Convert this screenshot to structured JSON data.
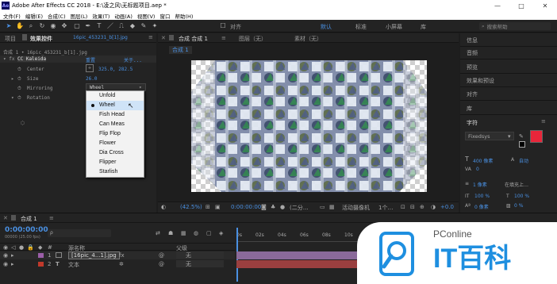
{
  "window": {
    "title": "Adobe After Effects CC 2018 - E:\\凌之风\\无标题项目.aep *",
    "logo_text": "Ae",
    "controls": [
      "—",
      "□",
      "✕"
    ]
  },
  "menu": [
    "文件(F)",
    "编辑(E)",
    "合成(C)",
    "图层(L)",
    "效果(T)",
    "动画(A)",
    "视图(V)",
    "窗口",
    "帮助(H)"
  ],
  "toolbar": {
    "align_label": "对齐",
    "workspaces": [
      "默认",
      "标准",
      "小屏幕",
      "库"
    ],
    "search_placeholder": "搜索帮助"
  },
  "project_panel": {
    "tab_project": "项目",
    "tab_effect": "效果控件",
    "tab_layer": "16pic_453231_b[1].jpg",
    "layer_path": "合成 1 • 16pic_453231_b[1].jpg",
    "effect_name": "CC Kaleida",
    "reset_label": "重置",
    "about_label": "关于...",
    "props": [
      {
        "label": "Center",
        "value": "325.0, 282.5"
      },
      {
        "label": "Size",
        "value": "26.0"
      },
      {
        "label": "Mirroring",
        "value": "Wheel"
      },
      {
        "label": "Rotation",
        "value": ""
      }
    ]
  },
  "dropdown": {
    "options": [
      "Unfold",
      "Wheel",
      "Fish Head",
      "Can Meas",
      "Flip Flop",
      "Flower",
      "Dia Cross",
      "Flipper",
      "Starlish"
    ],
    "selected": "Wheel"
  },
  "comp_panel": {
    "tab_comp": "合成 合成 1",
    "tab_layer": "图层（无）",
    "tab_footage": "素材（无）",
    "comp_label": "合成 1",
    "zoom": "(42.5%)",
    "timecode": "0:00:00:00",
    "resolution": "(二分…",
    "camera": "活动摄像机",
    "views": "1个…",
    "offset": "+0.0"
  },
  "right_panel": {
    "items": [
      "信息",
      "音频",
      "预览",
      "效果和预设",
      "对齐",
      "库",
      "字符"
    ],
    "font_name": "Fixedsys",
    "font_size": "400 像素",
    "leading": "自动",
    "kerning": "0",
    "stroke": "1 像素",
    "stroke_mode": "在填充上…",
    "vscale": "100 %",
    "hscale": "100 %",
    "baseline": "0 像素",
    "tsume": "0 %",
    "fill_color": "#e8263a"
  },
  "timeline": {
    "tab": "合成 1",
    "timecode": "0:00:00:00",
    "fps": "00000 (25.00 fps)",
    "search_placeholder": "ρ",
    "col_source": "源名称",
    "col_parent": "父级",
    "ruler": [
      "0s",
      "02s",
      "04s",
      "06s",
      "08s",
      "10s"
    ],
    "layers": [
      {
        "num": "1",
        "name": "[16pic_4...1].jpg",
        "parent": "无",
        "color": "#9b5fa8"
      },
      {
        "num": "2",
        "name": "文本",
        "parent": "无",
        "color": "#c0392b"
      }
    ]
  },
  "watermark": {
    "brand_top": "PConline",
    "brand_main": "IT百科"
  }
}
